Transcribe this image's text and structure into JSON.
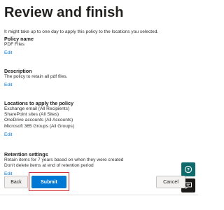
{
  "title": "Review and finish",
  "intro": "It might take up to one day to apply this policy to the locations you selected.",
  "sections": {
    "policy_name": {
      "heading": "Policy name",
      "lines": [
        "PDF Files"
      ],
      "edit": "Edit"
    },
    "description": {
      "heading": "Description",
      "lines": [
        "The policy to retain all pdf files."
      ],
      "edit": "Edit"
    },
    "locations": {
      "heading": "Locations to apply the policy",
      "lines": [
        "Exchange email (All Recipients)",
        "SharePoint sites (All Sites)",
        "OneDrive accounts (All Accounts)",
        "Microsoft 365 Groups (All Groups)"
      ],
      "edit": "Edit"
    },
    "retention": {
      "heading": "Retention settings",
      "lines": [
        "Retain items for 7 years based on when they were created",
        "Don't delete items at end of retention period"
      ],
      "edit": "Edit"
    }
  },
  "buttons": {
    "back": "Back",
    "submit": "Submit",
    "cancel": "Cancel"
  },
  "icons": {
    "help": "help-icon",
    "chat": "chat-icon"
  },
  "colors": {
    "accent": "#0078d4",
    "highlight": "#d13438"
  }
}
